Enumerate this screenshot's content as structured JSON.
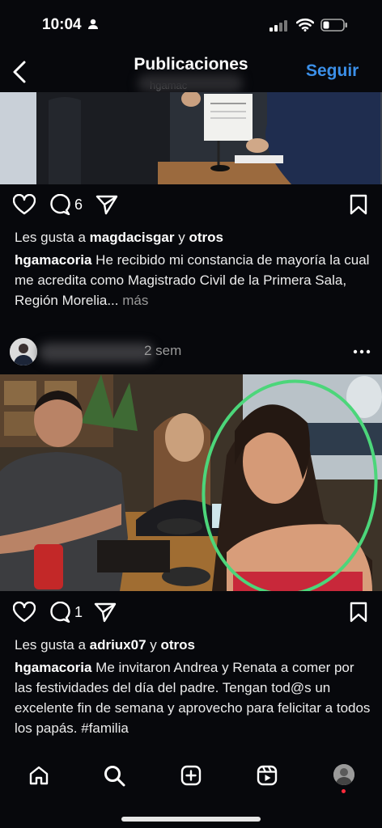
{
  "status": {
    "time": "10:04"
  },
  "header": {
    "title": "Publicaciones",
    "follow_label": "Seguir",
    "username_partial": "hgamac"
  },
  "post1": {
    "comment_count": "6",
    "liked_prefix": "Les gusta a ",
    "liked_user": "magdacisgar",
    "liked_mid": " y ",
    "liked_others": "otros",
    "author": "hgamacoria",
    "caption": " He recibido mi constancia de mayoría la cual me acredita como Magistrado Civil de la Primera Sala, Región Morelia...",
    "more_label": " más"
  },
  "post2": {
    "time_ago": "2 sem",
    "more_icon": "more-horizontal-icon",
    "comment_count": "1",
    "liked_prefix": "Les gusta a ",
    "liked_user": "adriux07",
    "liked_mid": " y ",
    "liked_others": "otros",
    "author": "hgamacoria",
    "caption": " Me invitaron Andrea y Renata a comer por las festividades del día del padre. Tengan tod@s un excelente fin de semana y aprovecho para felicitar a todos los papás.",
    "hashtag": "#familia"
  },
  "colors": {
    "accent": "#3b8fe8",
    "circle": "#4cd67a",
    "background": "#07080c"
  }
}
